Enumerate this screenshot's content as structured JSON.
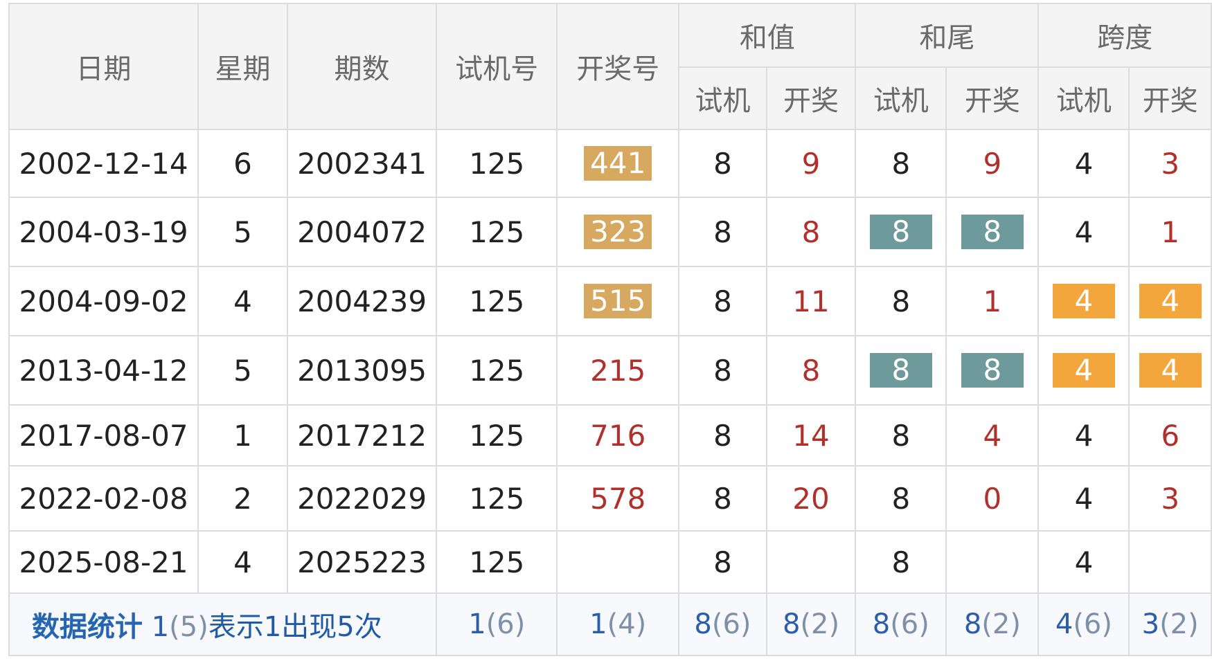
{
  "headers": {
    "date": "日期",
    "weekday": "星期",
    "issue": "期数",
    "trial": "试机号",
    "draw": "开奖号",
    "sum": "和值",
    "tail": "和尾",
    "span": "跨度",
    "sub_trial": "试机",
    "sub_draw": "开奖"
  },
  "rows": [
    {
      "date": "2002-12-14",
      "weekday": "6",
      "issue": "2002341",
      "trial": "125",
      "draw": "441",
      "sum_trial": "8",
      "sum_draw": "9",
      "tail_trial": "8",
      "tail_draw": "9",
      "span_trial": "4",
      "span_draw": "3"
    },
    {
      "date": "2004-03-19",
      "weekday": "5",
      "issue": "2004072",
      "trial": "125",
      "draw": "323",
      "sum_trial": "8",
      "sum_draw": "8",
      "tail_trial": "8",
      "tail_draw": "8",
      "span_trial": "4",
      "span_draw": "1"
    },
    {
      "date": "2004-09-02",
      "weekday": "4",
      "issue": "2004239",
      "trial": "125",
      "draw": "515",
      "sum_trial": "8",
      "sum_draw": "11",
      "tail_trial": "8",
      "tail_draw": "1",
      "span_trial": "4",
      "span_draw": "4"
    },
    {
      "date": "2013-04-12",
      "weekday": "5",
      "issue": "2013095",
      "trial": "125",
      "draw": "215",
      "sum_trial": "8",
      "sum_draw": "8",
      "tail_trial": "8",
      "tail_draw": "8",
      "span_trial": "4",
      "span_draw": "4"
    },
    {
      "date": "2017-08-07",
      "weekday": "1",
      "issue": "2017212",
      "trial": "125",
      "draw": "716",
      "sum_trial": "8",
      "sum_draw": "14",
      "tail_trial": "8",
      "tail_draw": "4",
      "span_trial": "4",
      "span_draw": "6"
    },
    {
      "date": "2022-02-08",
      "weekday": "2",
      "issue": "2022029",
      "trial": "125",
      "draw": "578",
      "sum_trial": "8",
      "sum_draw": "20",
      "tail_trial": "8",
      "tail_draw": "0",
      "span_trial": "4",
      "span_draw": "3"
    },
    {
      "date": "2025-08-21",
      "weekday": "4",
      "issue": "2025223",
      "trial": "125",
      "draw": "",
      "sum_trial": "8",
      "sum_draw": "",
      "tail_trial": "8",
      "tail_draw": "",
      "span_trial": "4",
      "span_draw": ""
    }
  ],
  "stats": {
    "label_bold": "数据统计",
    "label_example_n": "1",
    "label_example_p": "(5)",
    "label_rest": "表示1出现5次",
    "trial": {
      "n": "1",
      "p": "(6)"
    },
    "draw": {
      "n": "1",
      "p": "(4)"
    },
    "sum_trial": {
      "n": "8",
      "p": "(6)"
    },
    "sum_draw": {
      "n": "8",
      "p": "(2)"
    },
    "tail_trial": {
      "n": "8",
      "p": "(6)"
    },
    "tail_draw": {
      "n": "8",
      "p": "(2)"
    },
    "span_trial": {
      "n": "4",
      "p": "(6)"
    },
    "span_draw": {
      "n": "3",
      "p": "(2)"
    }
  },
  "colors": {
    "draw_repeat_highlight": "#d7a860",
    "tail_match_highlight": "#6f9a9c",
    "span_match_highlight": "#f3a63c",
    "draw_red_text": "#b0302c",
    "stat_blue": "#2666b0"
  }
}
